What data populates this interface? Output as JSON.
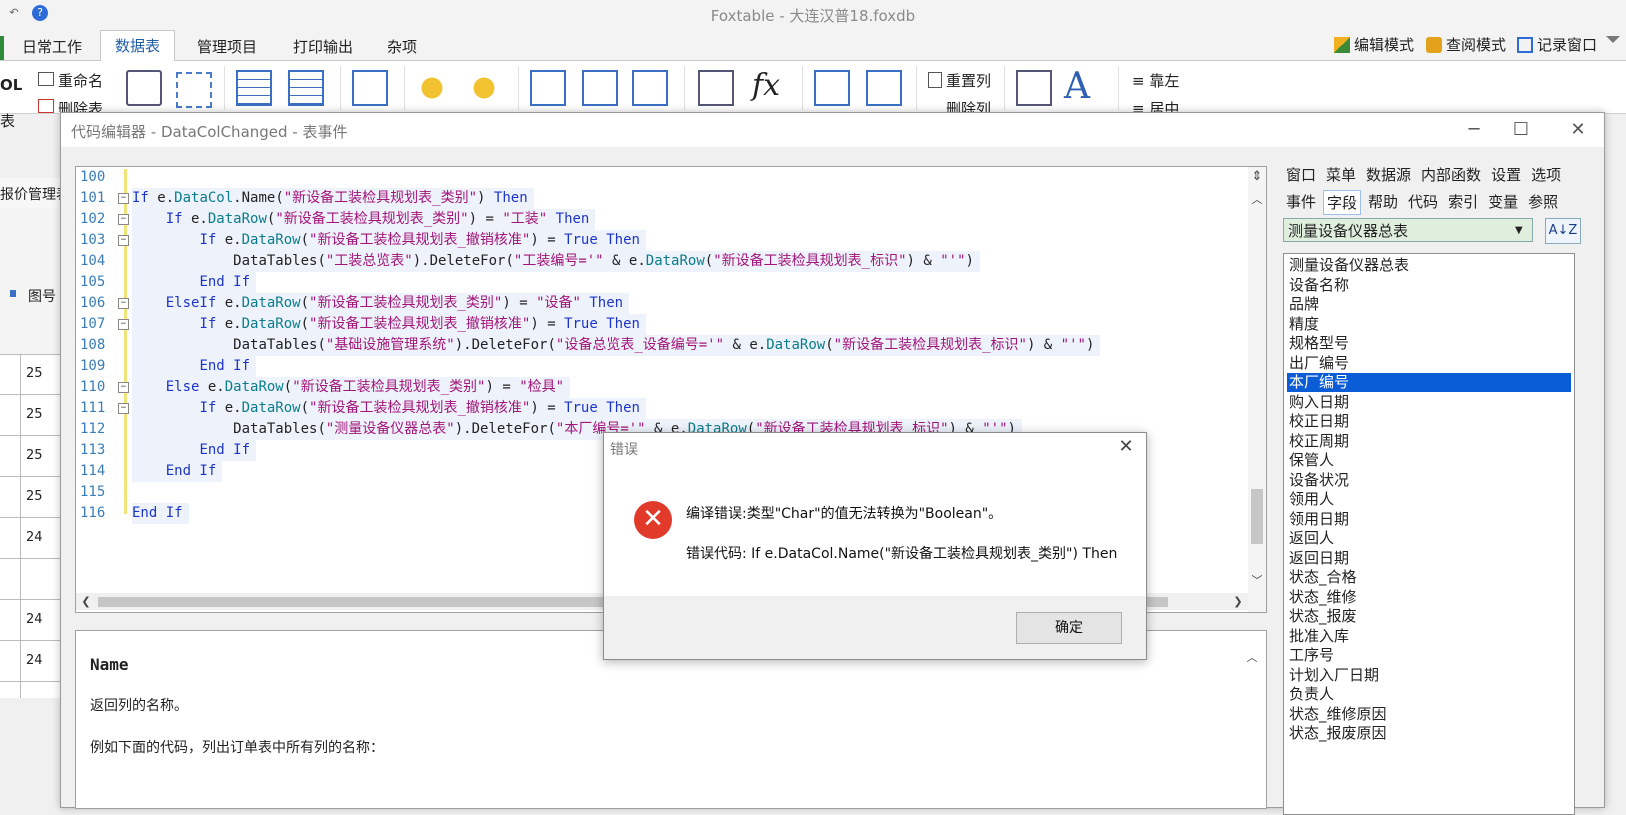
{
  "app": {
    "title": "Foxtable - 大连汉普18.foxdb",
    "ribbon_tabs": [
      "日常工作",
      "数据表",
      "管理项目",
      "打印输出",
      "杂项"
    ],
    "modes": [
      "编辑模式",
      "查阅模式",
      "记录窗口"
    ],
    "ribbon_text": {
      "rename": "重命名",
      "delete_table": "删除表",
      "reset_col": "重置列",
      "delete_col": "删除列",
      "align_left": "靠左",
      "align_center": "居中",
      "fx": "fx"
    },
    "left_fragments": {
      "ol": "OL",
      "table": "表",
      "report_manage": "报价管理表",
      "drawing_no": "图号"
    },
    "grid_numbers": [
      "25",
      "25",
      "25",
      "25",
      "24",
      "",
      "24",
      "24"
    ]
  },
  "editor": {
    "title": "代码编辑器 - DataColChanged - 表事件",
    "lines": [
      {
        "no": "100",
        "fold": "",
        "indent": "",
        "tokens": []
      },
      {
        "no": "101",
        "fold": "⊟",
        "indent": "",
        "tokens": [
          {
            "t": "If",
            "c": "kw"
          },
          {
            "t": " e.",
            "c": ""
          },
          {
            "t": "DataCol",
            "c": "obj"
          },
          {
            "t": ".Name(",
            "c": ""
          },
          {
            "t": "\"新设备工装检具规划表_类别\"",
            "c": "str"
          },
          {
            "t": ") ",
            "c": ""
          },
          {
            "t": "Then",
            "c": "kw"
          }
        ]
      },
      {
        "no": "102",
        "fold": "⊟",
        "indent": "    ",
        "tokens": [
          {
            "t": "If",
            "c": "kw"
          },
          {
            "t": " e.",
            "c": ""
          },
          {
            "t": "DataRow",
            "c": "obj"
          },
          {
            "t": "(",
            "c": ""
          },
          {
            "t": "\"新设备工装检具规划表_类别\"",
            "c": "str"
          },
          {
            "t": ") = ",
            "c": ""
          },
          {
            "t": "\"工装\"",
            "c": "str"
          },
          {
            "t": " ",
            "c": ""
          },
          {
            "t": "Then",
            "c": "kw"
          }
        ]
      },
      {
        "no": "103",
        "fold": "⊟",
        "indent": "        ",
        "tokens": [
          {
            "t": "If",
            "c": "kw"
          },
          {
            "t": " e.",
            "c": ""
          },
          {
            "t": "DataRow",
            "c": "obj"
          },
          {
            "t": "(",
            "c": ""
          },
          {
            "t": "\"新设备工装检具规划表_撤销核准\"",
            "c": "str"
          },
          {
            "t": ") = ",
            "c": ""
          },
          {
            "t": "True",
            "c": "kw"
          },
          {
            "t": " ",
            "c": ""
          },
          {
            "t": "Then",
            "c": "kw"
          }
        ]
      },
      {
        "no": "104",
        "fold": "",
        "indent": "            ",
        "tokens": [
          {
            "t": "DataTables(",
            "c": ""
          },
          {
            "t": "\"工装总览表\"",
            "c": "str"
          },
          {
            "t": ").DeleteFor(",
            "c": ""
          },
          {
            "t": "\"工装编号='\"",
            "c": "str"
          },
          {
            "t": " & e.",
            "c": ""
          },
          {
            "t": "DataRow",
            "c": "obj"
          },
          {
            "t": "(",
            "c": ""
          },
          {
            "t": "\"新设备工装检具规划表_标识\"",
            "c": "str"
          },
          {
            "t": ") & ",
            "c": ""
          },
          {
            "t": "\"'\"",
            "c": "str"
          },
          {
            "t": ")",
            "c": ""
          }
        ]
      },
      {
        "no": "105",
        "fold": "",
        "indent": "        ",
        "tokens": [
          {
            "t": "End If",
            "c": "kw"
          }
        ]
      },
      {
        "no": "106",
        "fold": "⊟",
        "indent": "    ",
        "tokens": [
          {
            "t": "ElseIf",
            "c": "kw"
          },
          {
            "t": " e.",
            "c": ""
          },
          {
            "t": "DataRow",
            "c": "obj"
          },
          {
            "t": "(",
            "c": ""
          },
          {
            "t": "\"新设备工装检具规划表_类别\"",
            "c": "str"
          },
          {
            "t": ") = ",
            "c": ""
          },
          {
            "t": "\"设备\"",
            "c": "str"
          },
          {
            "t": " ",
            "c": ""
          },
          {
            "t": "Then",
            "c": "kw"
          }
        ]
      },
      {
        "no": "107",
        "fold": "⊟",
        "indent": "        ",
        "tokens": [
          {
            "t": "If",
            "c": "kw"
          },
          {
            "t": " e.",
            "c": ""
          },
          {
            "t": "DataRow",
            "c": "obj"
          },
          {
            "t": "(",
            "c": ""
          },
          {
            "t": "\"新设备工装检具规划表_撤销核准\"",
            "c": "str"
          },
          {
            "t": ") = ",
            "c": ""
          },
          {
            "t": "True",
            "c": "kw"
          },
          {
            "t": " ",
            "c": ""
          },
          {
            "t": "Then",
            "c": "kw"
          }
        ]
      },
      {
        "no": "108",
        "fold": "",
        "indent": "            ",
        "tokens": [
          {
            "t": "DataTables(",
            "c": ""
          },
          {
            "t": "\"基础设施管理系统\"",
            "c": "str"
          },
          {
            "t": ").DeleteFor(",
            "c": ""
          },
          {
            "t": "\"设备总览表_设备编号='\"",
            "c": "str"
          },
          {
            "t": " & e.",
            "c": ""
          },
          {
            "t": "DataRow",
            "c": "obj"
          },
          {
            "t": "(",
            "c": ""
          },
          {
            "t": "\"新设备工装检具规划表_标识\"",
            "c": "str"
          },
          {
            "t": ") & ",
            "c": ""
          },
          {
            "t": "\"'\"",
            "c": "str"
          },
          {
            "t": ")",
            "c": ""
          }
        ]
      },
      {
        "no": "109",
        "fold": "",
        "indent": "        ",
        "tokens": [
          {
            "t": "End If",
            "c": "kw"
          }
        ]
      },
      {
        "no": "110",
        "fold": "⊟",
        "indent": "    ",
        "tokens": [
          {
            "t": "Else",
            "c": "kw"
          },
          {
            "t": " e.",
            "c": ""
          },
          {
            "t": "DataRow",
            "c": "obj"
          },
          {
            "t": "(",
            "c": ""
          },
          {
            "t": "\"新设备工装检具规划表_类别\"",
            "c": "str"
          },
          {
            "t": ") = ",
            "c": ""
          },
          {
            "t": "\"检具\"",
            "c": "str"
          }
        ]
      },
      {
        "no": "111",
        "fold": "⊟",
        "indent": "        ",
        "tokens": [
          {
            "t": "If",
            "c": "kw"
          },
          {
            "t": " e.",
            "c": ""
          },
          {
            "t": "DataRow",
            "c": "obj"
          },
          {
            "t": "(",
            "c": ""
          },
          {
            "t": "\"新设备工装检具规划表_撤销核准\"",
            "c": "str"
          },
          {
            "t": ") = ",
            "c": ""
          },
          {
            "t": "True",
            "c": "kw"
          },
          {
            "t": " ",
            "c": ""
          },
          {
            "t": "Then",
            "c": "kw"
          }
        ]
      },
      {
        "no": "112",
        "fold": "",
        "indent": "            ",
        "tokens": [
          {
            "t": "DataTables(",
            "c": ""
          },
          {
            "t": "\"测量设备仪器总表\"",
            "c": "str"
          },
          {
            "t": ").DeleteFor(",
            "c": ""
          },
          {
            "t": "\"本厂编号='\"",
            "c": "str"
          },
          {
            "t": " & e.",
            "c": ""
          },
          {
            "t": "DataRow",
            "c": "obj"
          },
          {
            "t": "(",
            "c": ""
          },
          {
            "t": "\"新设备工装检具规划表_标识\"",
            "c": "str"
          },
          {
            "t": ") & ",
            "c": ""
          },
          {
            "t": "\"'\"",
            "c": "str"
          },
          {
            "t": ")",
            "c": ""
          }
        ]
      },
      {
        "no": "113",
        "fold": "",
        "indent": "        ",
        "tokens": [
          {
            "t": "End If",
            "c": "kw"
          }
        ]
      },
      {
        "no": "114",
        "fold": "",
        "indent": "    ",
        "tokens": [
          {
            "t": "End If",
            "c": "kw"
          }
        ]
      },
      {
        "no": "115",
        "fold": "",
        "indent": "",
        "tokens": []
      },
      {
        "no": "116",
        "fold": "",
        "indent": "",
        "tokens": [
          {
            "t": "End If",
            "c": "kw"
          }
        ]
      }
    ],
    "help": {
      "title": "Name",
      "description": "返回列的名称。",
      "example": "例如下面的代码，列出订单表中所有列的名称："
    }
  },
  "side_panel": {
    "menu_row1": [
      "窗口",
      "菜单",
      "数据源",
      "内部函数",
      "设置",
      "选项"
    ],
    "menu_row2": [
      "事件",
      "字段",
      "帮助",
      "代码",
      "索引",
      "变量",
      "参照"
    ],
    "active_menu": "字段",
    "selected_table": "测量设备仪器总表",
    "sort_label": "A↓Z",
    "fields": [
      "测量设备仪器总表",
      "设备名称",
      "品牌",
      "精度",
      "规格型号",
      "出厂编号",
      "本厂编号",
      "购入日期",
      "校正日期",
      "校正周期",
      "保管人",
      "设备状况",
      "领用人",
      "领用日期",
      "返回人",
      "返回日期",
      "状态_合格",
      "状态_维修",
      "状态_报废",
      "批准入库",
      "工序号",
      "计划入厂日期",
      "负责人",
      "状态_维修原因",
      "状态_报废原因"
    ],
    "selected_field": "本厂编号"
  },
  "error_dialog": {
    "title": "错误",
    "message": "编译错误:类型\"Char\"的值无法转换为\"Boolean\"。",
    "code_label": "错误代码:  If e.DataCol.Name(\"新设备工装检具规划表_类别\") Then",
    "ok_label": "确定",
    "close_glyph": "✕",
    "icon_glyph": "✕"
  },
  "colors": {
    "keyword": "#1c34c8",
    "string": "#a3157b",
    "object": "#0a7c8c",
    "line_number": "#3b7db6",
    "selection": "#0a5cd7",
    "error_red": "#e23a2a"
  }
}
